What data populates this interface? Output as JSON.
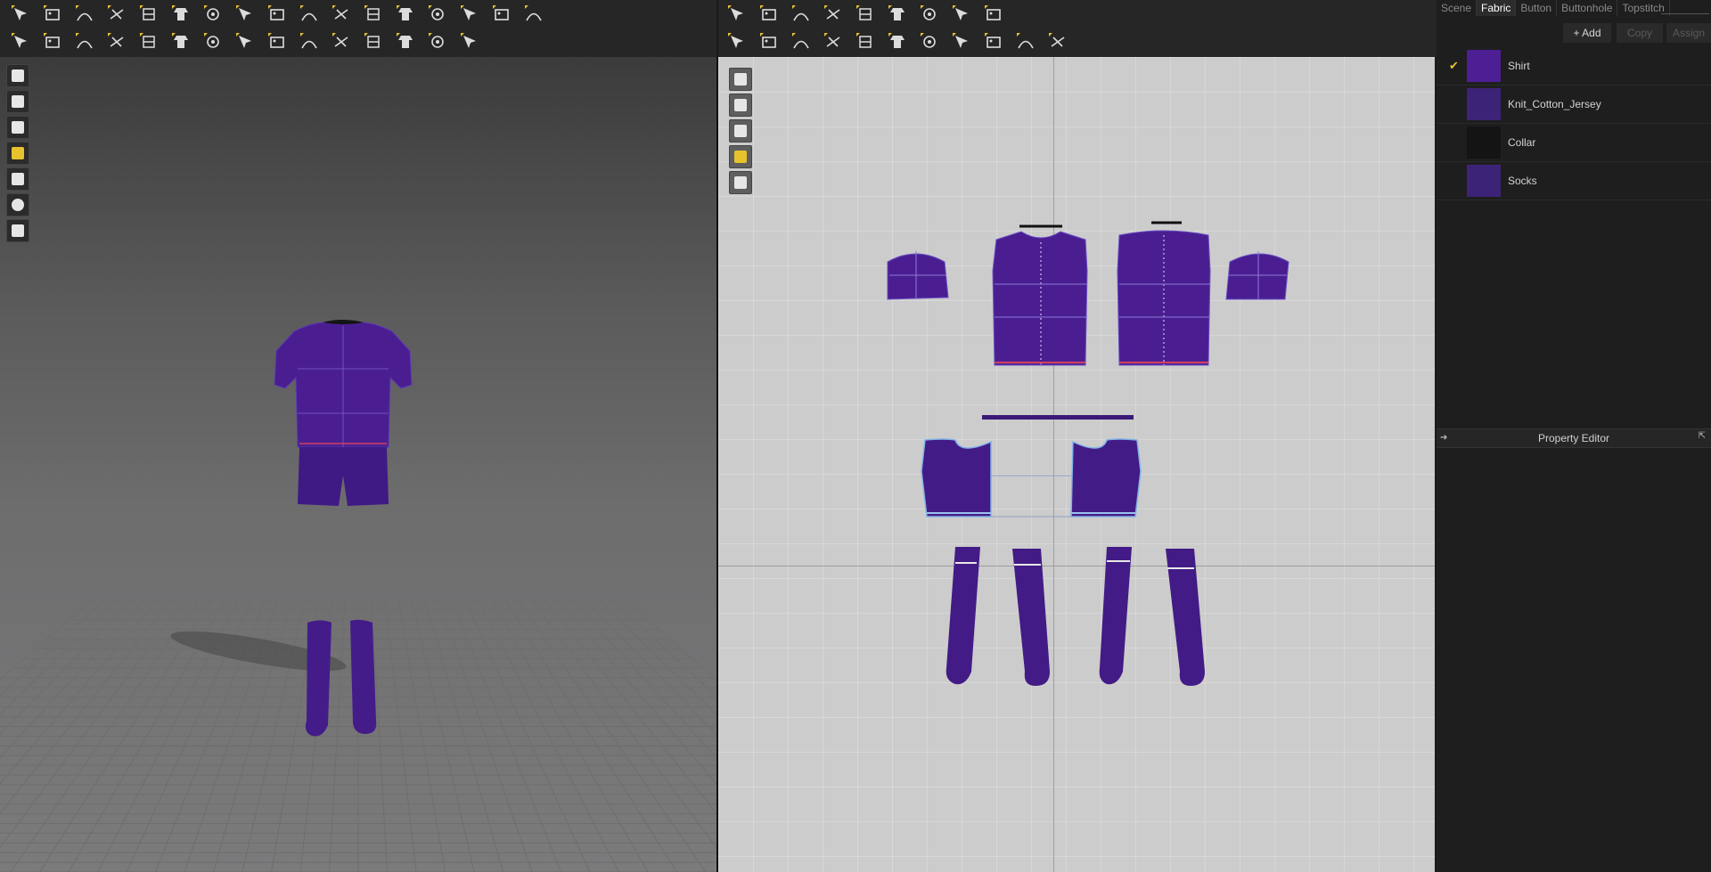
{
  "toolbar3d": {
    "row1": [
      "avatar-load-icon",
      "select-move-icon",
      "transform-pattern-icon",
      "edit-pattern-icon",
      "segment-icon",
      "curve-icon",
      "pin-icon",
      "tack-icon",
      "fold-icon",
      "strap-icon",
      "garment-fit-icon",
      "shirt-icon",
      "box-icon",
      "stack-icon",
      "spool-icon",
      "grid-icon",
      "mesh-icon"
    ],
    "row2": [
      "walk-icon",
      "brush-icon",
      "steam-icon",
      "measure-icon",
      "tape-icon",
      "seam-icon",
      "stitch-icon",
      "pattern-icon",
      "button-icon",
      "button-round-icon",
      "lock-icon",
      "zipper-icon",
      "edge-icon",
      "flat-edge-icon",
      "arrow-move-icon"
    ]
  },
  "toolbar2d": {
    "row1": [
      "select-icon",
      "points-icon",
      "edit-shape-icon",
      "polygon-icon",
      "rectangle-icon",
      "hide-icon",
      "layer-icon",
      "grid-icon",
      "mesh-icon"
    ],
    "row2": [
      "segment-sew-icon",
      "free-sew-icon",
      "curve-sew-icon",
      "tack-icon",
      "iron-icon",
      "shirt-icon",
      "fold-icon",
      "pattern-icon",
      "symmetry-icon",
      "line-icon",
      "dash-icon"
    ]
  },
  "side3d": [
    "show-garment-icon",
    "show-points-icon",
    "show-avatar-icon",
    "texture-icon",
    "flat-icon",
    "avatar-skin-icon",
    "globe-icon"
  ],
  "side2d": [
    "brush-view-icon",
    "show-garment-icon",
    "info-icon",
    "texture-icon",
    "lock-icon"
  ],
  "panel": {
    "tabs": [
      "Scene",
      "Fabric",
      "Button",
      "Buttonhole",
      "Topstitch"
    ],
    "active_tab": "Fabric",
    "add_label": "+ Add",
    "copy_label": "Copy",
    "assign_label": "Assign",
    "fabrics": [
      {
        "name": "Shirt",
        "color": "#4d1f94",
        "checked": true
      },
      {
        "name": "Knit_Cotton_Jersey",
        "color": "#3d2378",
        "checked": false
      },
      {
        "name": "Collar",
        "color": "#141414",
        "checked": false
      },
      {
        "name": "Socks",
        "color": "#3d2378",
        "checked": false
      }
    ],
    "property_editor_label": "Property Editor"
  },
  "colors": {
    "garment": "#4a1e91",
    "garment_dark": "#3c1877",
    "accent_yellow": "#e8c22c"
  }
}
